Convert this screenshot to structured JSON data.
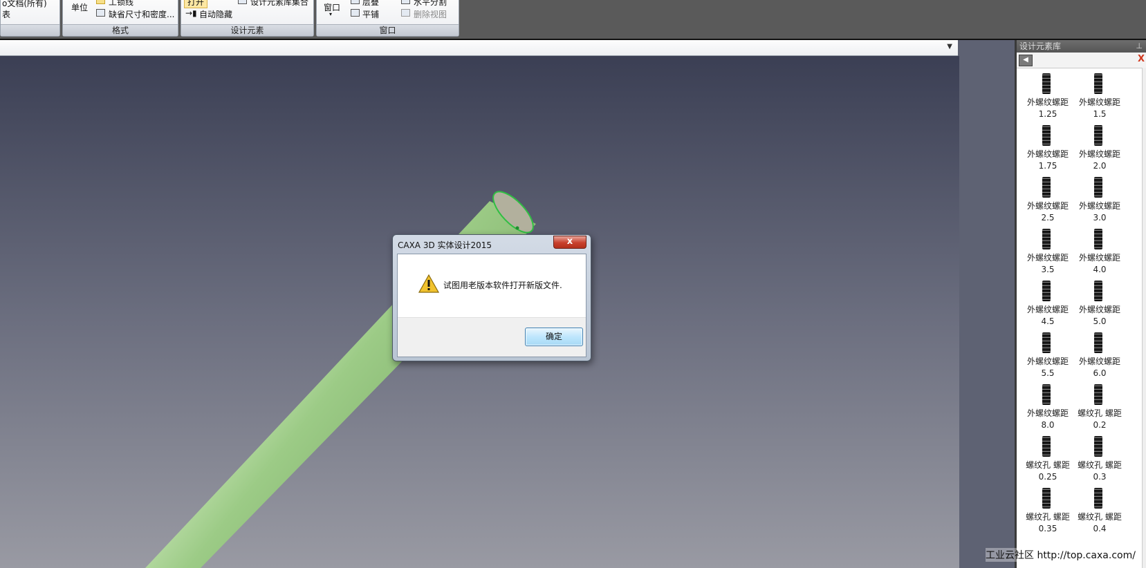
{
  "ribbon": {
    "left_group": {
      "line1": "ο文档(所有)",
      "line2": "表"
    },
    "format_group": {
      "unit": "单位",
      "item1": "工锁线",
      "item2": "缺省尺寸和密度...",
      "title": "格式"
    },
    "design_group": {
      "open": "打开",
      "library_set": "设计元素库集合",
      "auto_hide": "自动隐藏",
      "title": "设计元素"
    },
    "window_group": {
      "window": "窗口",
      "cascade": "层叠",
      "tile": "平铺",
      "split_h": "水平分割",
      "delete_view": "删除视图",
      "title": "窗口"
    }
  },
  "dialog": {
    "title": "CAXA 3D 实体设计2015",
    "close_symbol": "x",
    "message": "试图用老版本软件打开新版文件.",
    "ok_label": "确定"
  },
  "panel": {
    "title": "设计元素库",
    "pin_symbol": "⊥",
    "back_symbol": "◀",
    "close_symbol": "X",
    "items": [
      {
        "label1": "外螺纹螺距",
        "label2": "1.25"
      },
      {
        "label1": "外螺纹螺距",
        "label2": "1.5"
      },
      {
        "label1": "外螺纹螺距",
        "label2": "1.75"
      },
      {
        "label1": "外螺纹螺距",
        "label2": "2.0"
      },
      {
        "label1": "外螺纹螺距",
        "label2": "2.5"
      },
      {
        "label1": "外螺纹螺距",
        "label2": "3.0"
      },
      {
        "label1": "外螺纹螺距",
        "label2": "3.5"
      },
      {
        "label1": "外螺纹螺距",
        "label2": "4.0"
      },
      {
        "label1": "外螺纹螺距",
        "label2": "4.5"
      },
      {
        "label1": "外螺纹螺距",
        "label2": "5.0"
      },
      {
        "label1": "外螺纹螺距",
        "label2": "5.5"
      },
      {
        "label1": "外螺纹螺距",
        "label2": "6.0"
      },
      {
        "label1": "外螺纹螺距",
        "label2": "8.0"
      },
      {
        "label1": "螺纹孔 螺距",
        "label2": "0.2"
      },
      {
        "label1": "螺纹孔 螺距",
        "label2": "0.25"
      },
      {
        "label1": "螺纹孔 螺距",
        "label2": "0.3"
      },
      {
        "label1": "螺纹孔 螺距",
        "label2": "0.35"
      },
      {
        "label1": "螺纹孔 螺距",
        "label2": "0.4"
      }
    ]
  },
  "watermark": "工业云社区 http://top.caxa.com/",
  "colors": {
    "pipe": "#8fc07a",
    "viewport_top": "#3b3f54",
    "viewport_bottom": "#999aa3",
    "close_red": "#c8402c"
  }
}
